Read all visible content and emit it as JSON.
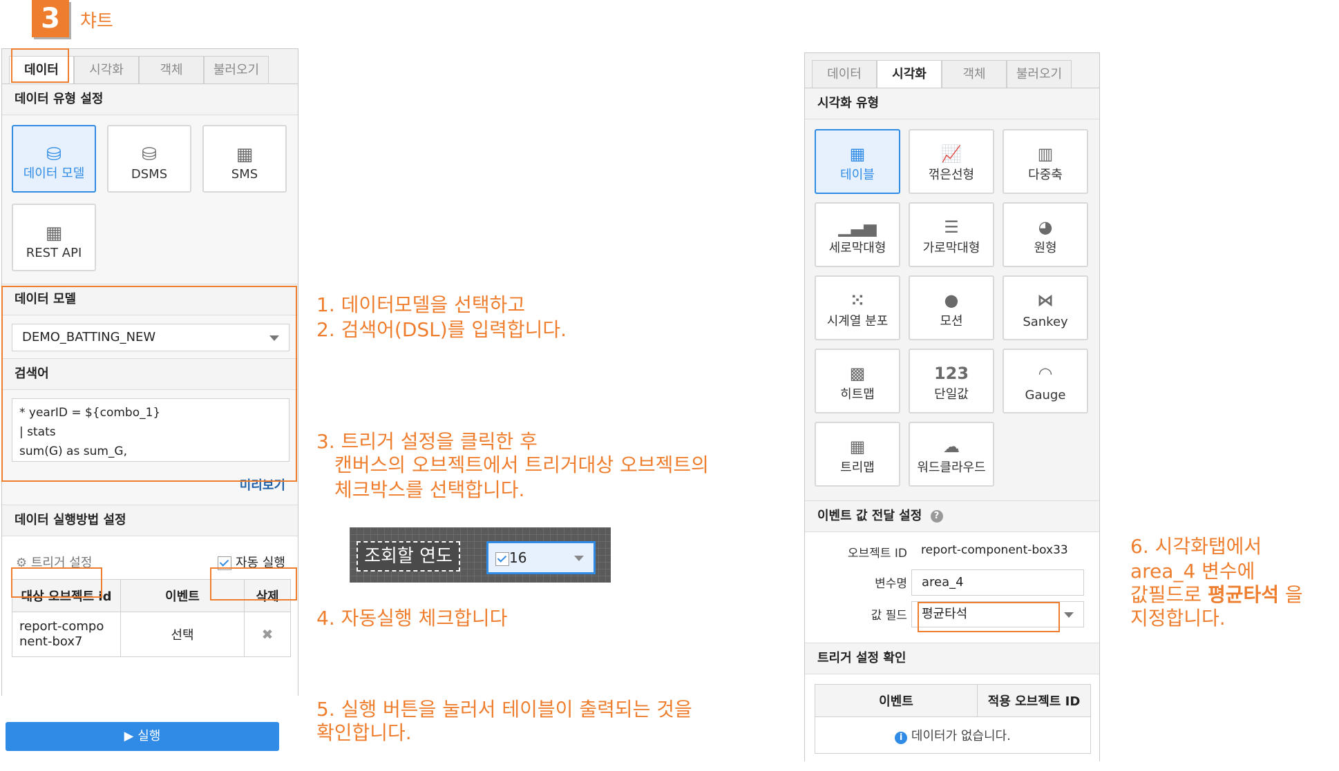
{
  "header": {
    "step": "3",
    "title": "챠트"
  },
  "left_panel": {
    "tabs": [
      "데이터",
      "시각화",
      "객체",
      "불러오기"
    ],
    "data_type_section": "데이터 유형 설정",
    "data_types": [
      "데이터 모델",
      "DSMS",
      "SMS",
      "REST API"
    ],
    "data_model_section": "데이터 모델",
    "data_model_value": "DEMO_BATTING_NEW",
    "query_section": "검색어",
    "query_lines": [
      "* yearID = ${combo_1}",
      "| stats",
      "sum(G) as sum_G,"
    ],
    "preview_link": "미리보기",
    "exec_section": "데이터 실행방법 설정",
    "trigger_setting": "트리거 설정",
    "auto_run": "자동 실행",
    "table_headers": [
      "대상 오브젝트 id",
      "이벤트",
      "삭제"
    ],
    "table_row": {
      "object_id": "report-compo\nnent-box7",
      "event": "선택",
      "delete_icon": "x-icon"
    },
    "run_button": "실행"
  },
  "canvas_snippet": {
    "label": "조회할 연도",
    "value": "16"
  },
  "notes": {
    "note1": "1. 데이터모델을 선택하고",
    "note2": "2. 검색어(DSL)를 입력합니다.",
    "note3a": "3. 트리거 설정을 클릭한 후",
    "note3b": "캔버스의 오브젝트에서 트리거대상 오브젝트의",
    "note3c": "체크박스를 선택합니다.",
    "note4": "4. 자동실행 체크합니다",
    "note5a": "5. 실행 버튼을 눌러서 테이블이 출력되는 것을",
    "note5b": "확인합니다.",
    "note6a": "6. 시각화탭에서",
    "note6b": "area_4 변수에",
    "note6c_pre": "값필드로 ",
    "note6c_bold": "평균타석",
    "note6c_post": " 을",
    "note6d": "지정합니다."
  },
  "right_panel": {
    "tabs": [
      "데이터",
      "시각화",
      "객체",
      "불러오기"
    ],
    "vis_type_section": "시각화 유형",
    "vis_types": [
      "테이블",
      "꺾은선형",
      "다중축",
      "세로막대형",
      "가로막대형",
      "원형",
      "시계열 분포",
      "모션",
      "Sankey",
      "히트맵",
      "단일값",
      "Gauge",
      "트리맵",
      "워드클라우드"
    ],
    "single_value_icon_text": "123",
    "event_section": "이벤트 값 전달 설정",
    "object_id_label": "오브젝트 ID",
    "object_id_value": "report-component-box33",
    "var_label": "변수명",
    "var_value": "area_4",
    "field_label": "값 필드",
    "field_value": "평균타석",
    "trigger_confirm_section": "트리거 설정 확인",
    "confirm_headers": [
      "이벤트",
      "적용 오브젝트 ID"
    ],
    "empty_text": "데이터가 없습니다."
  },
  "colors": {
    "accent_orange": "#ee7e2e",
    "accent_blue": "#2f8be6"
  }
}
